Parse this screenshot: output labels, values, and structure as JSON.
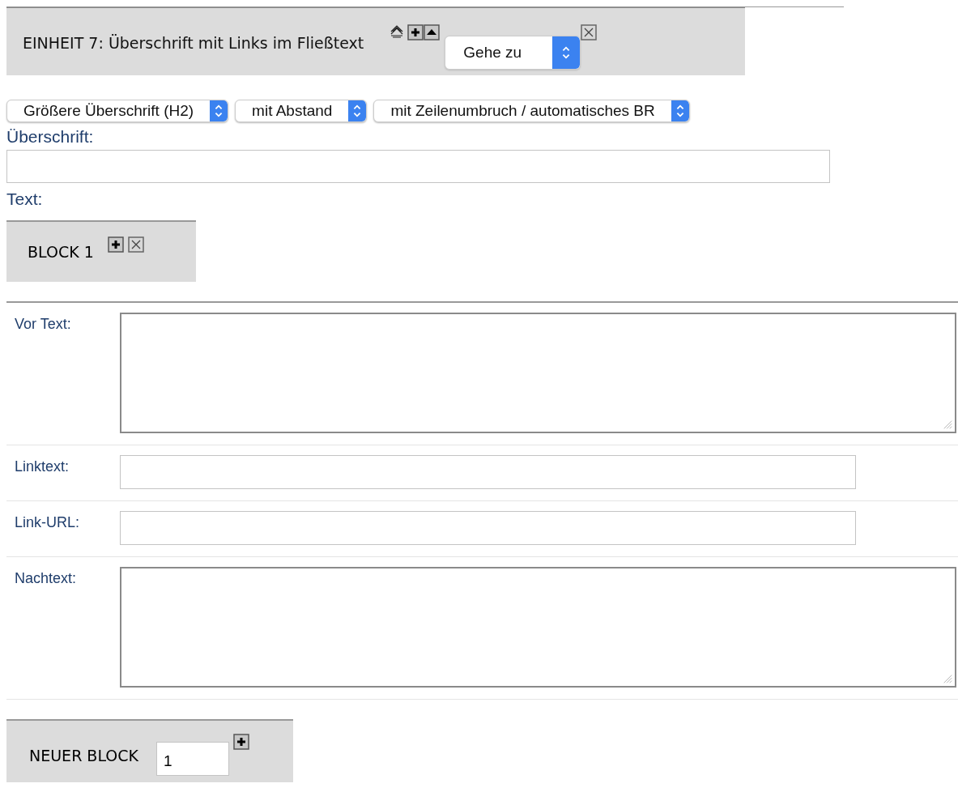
{
  "unit": {
    "title": "EINHEIT 7: Überschrift mit Links im Fließtext",
    "goto": "Gehe zu"
  },
  "selects": [
    {
      "value": "Größere Überschrift (H2)"
    },
    {
      "value": "mit Abstand"
    },
    {
      "value": "mit Zeilenumbruch / automatisches BR"
    }
  ],
  "heading": {
    "label": "Überschrift:"
  },
  "text_label": "Text:",
  "block": {
    "title": "BLOCK 1"
  },
  "fields": [
    {
      "kind": "textarea",
      "label": "Vor Text:"
    },
    {
      "kind": "input",
      "label": "Linktext:"
    },
    {
      "kind": "input",
      "label": "Link-URL:"
    },
    {
      "kind": "textarea",
      "label": "Nachtext:"
    }
  ],
  "new_block": {
    "label": "NEUER BLOCK",
    "value": "1"
  }
}
